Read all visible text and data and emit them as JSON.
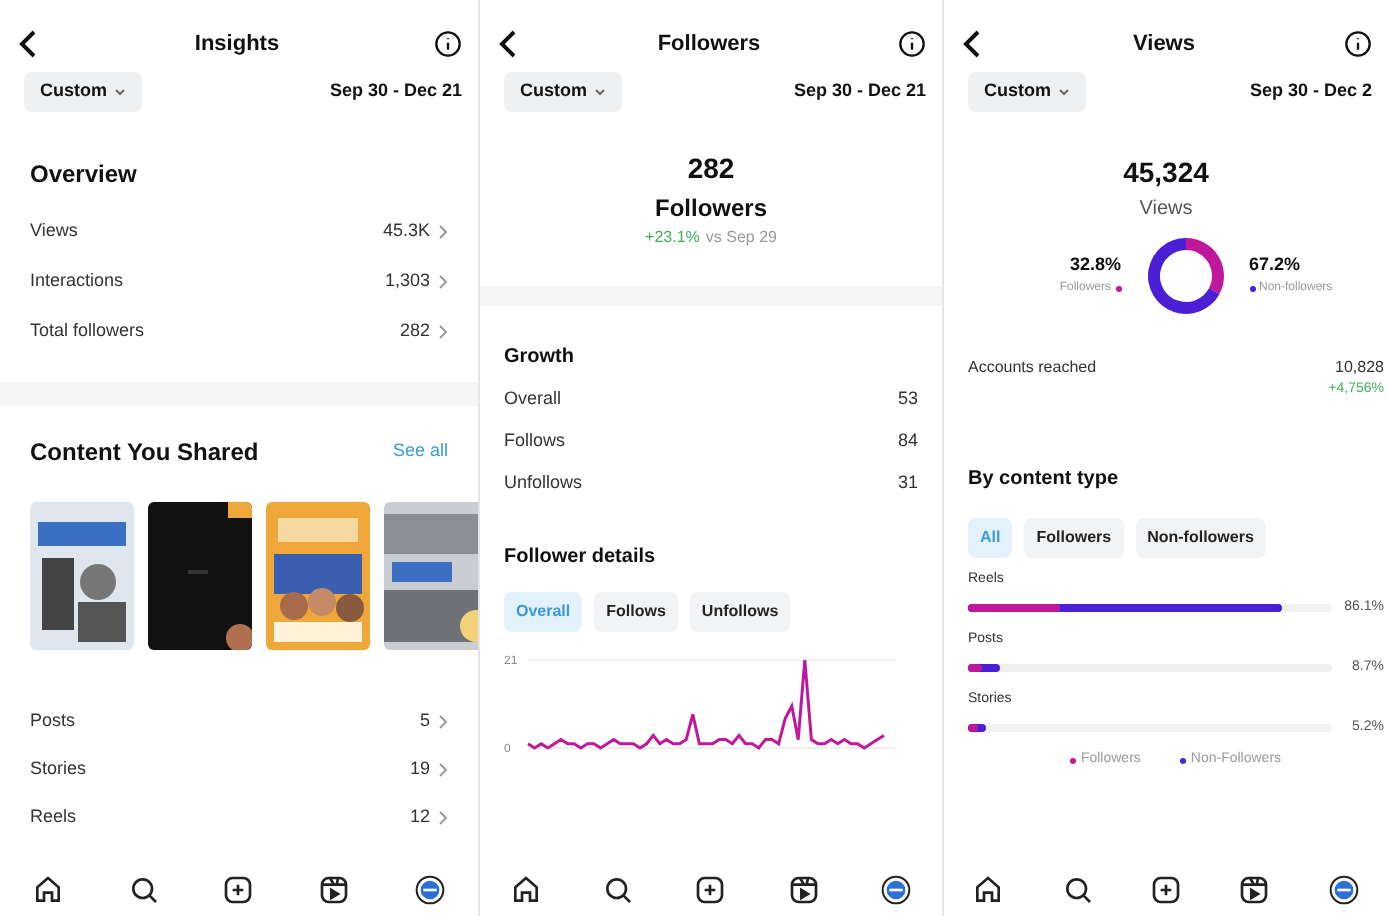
{
  "screens": [
    {
      "kind": "insights",
      "title": "Insights",
      "filter": "Custom",
      "date_range": "Sep 30 - Dec 21",
      "overview": {
        "title": "Overview",
        "rows": [
          {
            "label": "Views",
            "value": "45.3K"
          },
          {
            "label": "Interactions",
            "value": "1,303"
          },
          {
            "label": "Total followers",
            "value": "282"
          }
        ]
      },
      "content": {
        "title": "Content You Shared",
        "link": "See all",
        "rows": [
          {
            "label": "Posts",
            "value": "5"
          },
          {
            "label": "Stories",
            "value": "19"
          },
          {
            "label": "Reels",
            "value": "12"
          }
        ]
      }
    },
    {
      "kind": "followers",
      "title": "Followers",
      "filter": "Custom",
      "date_range": "Sep 30 - Dec 21",
      "total": "282",
      "total_label": "Followers",
      "change": "+23.1%",
      "change_note": "vs Sep 29",
      "growth": {
        "title": "Growth",
        "rows": [
          {
            "label": "Overall",
            "value": "53"
          },
          {
            "label": "Follows",
            "value": "84"
          },
          {
            "label": "Unfollows",
            "value": "31"
          }
        ]
      },
      "details": {
        "title": "Follower details",
        "tabs": [
          {
            "label": "Overall",
            "selected": true
          },
          {
            "label": "Follows",
            "selected": false
          },
          {
            "label": "Unfollows",
            "selected": false
          }
        ],
        "chart_data": {
          "type": "line",
          "yticks": [
            0,
            21
          ],
          "ylim": [
            0,
            21
          ],
          "series": [
            {
              "color": "#c0189c",
              "values": [
                1,
                0,
                1,
                0,
                1,
                2,
                1,
                1,
                0,
                1,
                1,
                0,
                1,
                2,
                1,
                1,
                1,
                0,
                1,
                3,
                1,
                2,
                1,
                1,
                2,
                8,
                1,
                1,
                1,
                2,
                2,
                1,
                3,
                1,
                1,
                0,
                2,
                2,
                1,
                7,
                10,
                2,
                21,
                2,
                1,
                1,
                2,
                1,
                2,
                1,
                1,
                0,
                1,
                2,
                3
              ]
            }
          ]
        }
      }
    },
    {
      "kind": "views",
      "title": "Views",
      "filter": "Custom",
      "date_range": "Sep 30 - Dec 2",
      "total": "45,324",
      "total_label": "Views",
      "split": {
        "chart_data": {
          "type": "donut",
          "categories": [
            "Followers",
            "Non-followers"
          ],
          "series": [
            {
              "values": [
                32.8,
                67.2
              ]
            }
          ],
          "colors": [
            "#c0189c",
            "#4a1fd6"
          ]
        },
        "left": {
          "value": "32.8%"
        },
        "right": {
          "value": "67.2%"
        }
      },
      "reach": {
        "label": "Accounts reached",
        "value": "10,828",
        "change": "+4,756%"
      },
      "by_type": {
        "title": "By content type",
        "tabs": [
          {
            "label": "All",
            "selected": true
          },
          {
            "label": "Followers",
            "selected": false
          },
          {
            "label": "Non-followers",
            "selected": false
          }
        ],
        "rows": [
          {
            "label": "Reels",
            "value": "86.1%",
            "segments": [
              {
                "level": 0.25,
                "color": "#c0189c"
              },
              {
                "level": 0.86,
                "color": "#4a1fd6"
              }
            ]
          },
          {
            "label": "Posts",
            "value": "8.7%",
            "segments": [
              {
                "level": 0.04,
                "color": "#c0189c"
              },
              {
                "level": 0.09,
                "color": "#4a1fd6"
              }
            ]
          },
          {
            "label": "Stories",
            "value": "5.2%",
            "segments": [
              {
                "level": 0.03,
                "color": "#c0189c"
              },
              {
                "level": 0.05,
                "color": "#4a1fd6"
              }
            ]
          }
        ],
        "legend": [
          {
            "label": "Followers",
            "color": "#c0189c"
          },
          {
            "label": "Non-Followers",
            "color": "#4a1fd6"
          }
        ]
      }
    }
  ],
  "nav": [
    {
      "kind": "home"
    },
    {
      "kind": "search"
    },
    {
      "kind": "create"
    },
    {
      "kind": "reels"
    },
    {
      "kind": "profile"
    }
  ]
}
